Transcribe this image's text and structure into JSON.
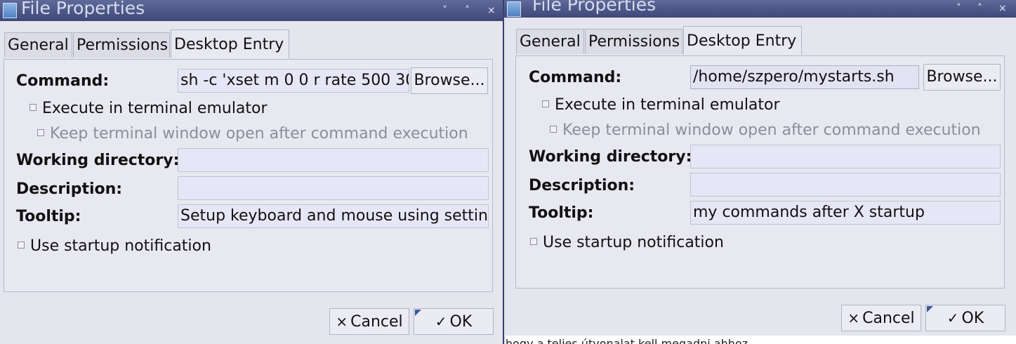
{
  "windows": [
    {
      "title": "File Properties",
      "tabs": [
        "General",
        "Permissions",
        "Desktop Entry"
      ],
      "command_label": "Command:",
      "command_value": "sh -c 'xset m 0 0 r rate 500 30",
      "browse_label": "Browse...",
      "exec_terminal_label": "Execute in terminal emulator",
      "keep_open_label": "Keep terminal window open after command execution",
      "workdir_label": "Working directory:",
      "workdir_value": "",
      "description_label": "Description:",
      "description_value": "",
      "tooltip_label": "Tooltip:",
      "tooltip_value": "Setup keyboard and mouse using settin",
      "startup_notify_label": "Use startup notification",
      "cancel_label": "Cancel",
      "ok_label": "OK"
    },
    {
      "title": "File Properties",
      "tabs": [
        "General",
        "Permissions",
        "Desktop Entry"
      ],
      "command_label": "Command:",
      "command_value": "/home/szpero/mystarts.sh",
      "browse_label": "Browse...",
      "exec_terminal_label": "Execute in terminal emulator",
      "keep_open_label": "Keep terminal window open after command execution",
      "workdir_label": "Working directory:",
      "workdir_value": "",
      "description_label": "Description:",
      "description_value": "",
      "tooltip_label": "Tooltip:",
      "tooltip_value": "my commands after X startup",
      "startup_notify_label": "Use startup notification",
      "cancel_label": "Cancel",
      "ok_label": "OK"
    }
  ],
  "icons": {
    "minimize": "˅",
    "maximize": "˄",
    "close": "×",
    "cancel": "×",
    "ok": "✓"
  },
  "background_text": "hogy a teljes útvonalat kell megadni ahhoz"
}
